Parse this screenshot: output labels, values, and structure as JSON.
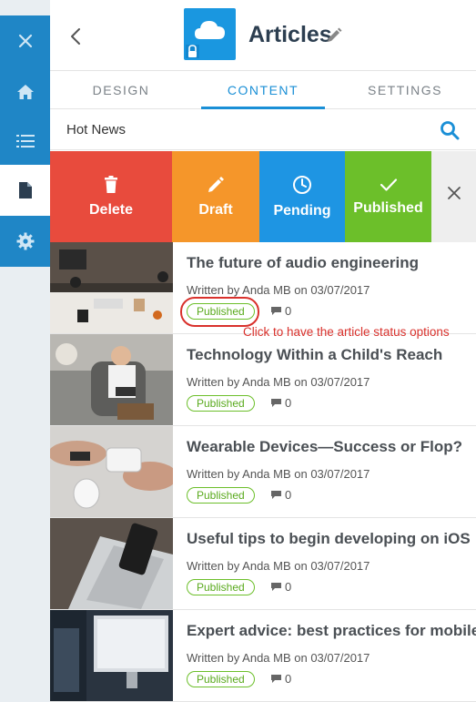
{
  "rail": {
    "items": [
      {
        "icon": "close-icon"
      },
      {
        "icon": "home-icon"
      },
      {
        "icon": "list-icon"
      },
      {
        "icon": "document-icon",
        "active": true
      },
      {
        "icon": "gear-icon"
      }
    ]
  },
  "header": {
    "title": "Articles",
    "app_icon": "cloud-lock-icon"
  },
  "tabs": [
    {
      "label": "DESIGN"
    },
    {
      "label": "CONTENT",
      "active": true
    },
    {
      "label": "SETTINGS"
    }
  ],
  "search": {
    "value": "Hot News"
  },
  "actions": {
    "delete": "Delete",
    "draft": "Draft",
    "pending": "Pending",
    "published": "Published"
  },
  "articles": [
    {
      "title": "The future of audio engineering",
      "meta": "Written by Anda MB on 03/07/2017",
      "status": "Published",
      "comments": "0"
    },
    {
      "title": "Technology Within a Child's Reach",
      "meta": "Written by Anda MB on 03/07/2017",
      "status": "Published",
      "comments": "0"
    },
    {
      "title": "Wearable Devices—Success or Flop?",
      "meta": "Written by Anda MB on 03/07/2017",
      "status": "Published",
      "comments": "0"
    },
    {
      "title": "Useful tips to begin developing on iOS",
      "meta": "Written by Anda MB on 03/07/2017",
      "status": "Published",
      "comments": "0"
    },
    {
      "title": "Expert advice: best practices for mobile",
      "meta": "Written by Anda MB on 03/07/2017",
      "status": "Published",
      "comments": "0"
    }
  ],
  "annotation": {
    "hint": "Click to have the article status options"
  },
  "colors": {
    "brand_blue": "#1f86c6",
    "delete": "#e84b3d",
    "draft": "#f5962a",
    "pending": "#1e95e3",
    "published": "#6cbf2a",
    "annotation": "#d9312c"
  }
}
